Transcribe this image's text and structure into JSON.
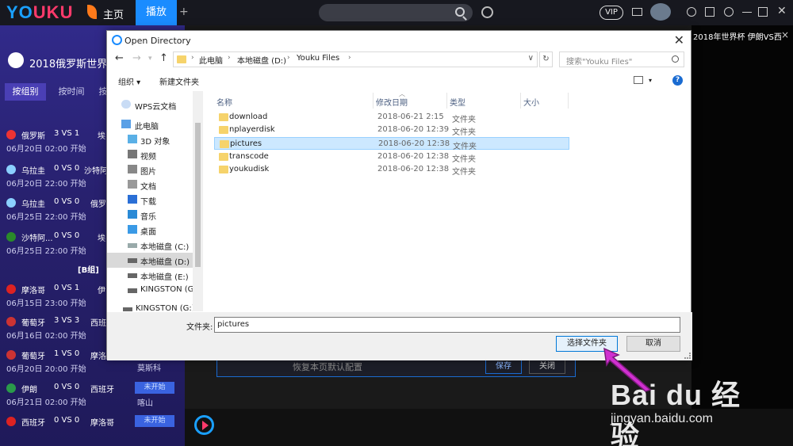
{
  "app": {
    "logo_text_a": "YO",
    "logo_text_b": "UKU",
    "nav_home": "主页",
    "nav_play": "播放",
    "nav_plus": "+",
    "vip": "VIP",
    "right_title": "2018年世界杯 伊朗VS西",
    "right_close": "×",
    "colors": {
      "accent": "#1a8cff",
      "brand_pink": "#ff3a6b",
      "panel": "#2b247a"
    }
  },
  "worldcup": {
    "title": "2018俄罗斯世界杯",
    "tabs": [
      "按组别",
      "按时间",
      "按"
    ],
    "group_b": "[B组]",
    "matches": [
      {
        "team": "俄罗斯",
        "score": "3 VS 1",
        "opp": "埃",
        "time": "06月20日 02:00 开始"
      },
      {
        "team": "乌拉圭",
        "score": "0 VS 0",
        "opp": "沙特阿",
        "time": "06月20日 22:00 开始"
      },
      {
        "team": "乌拉圭",
        "score": "0 VS 0",
        "opp": "俄罗",
        "time": "06月25日 22:00 开始"
      },
      {
        "team": "沙特阿...",
        "score": "0 VS 0",
        "opp": "埃",
        "time": "06月25日 22:00 开始"
      },
      {
        "team": "摩洛哥",
        "score": "0 VS 1",
        "opp": "伊",
        "time": "06月15日 23:00 开始"
      },
      {
        "team": "葡萄牙",
        "score": "3 VS 3",
        "opp": "西班",
        "time": "06月16日 02:00 开始"
      },
      {
        "team": "葡萄牙",
        "score": "1 VS 0",
        "opp": "摩洛",
        "time": "06月20日 20:00 开始"
      },
      {
        "team": "伊朗",
        "score": "0 VS 0",
        "opp": "西班牙",
        "time": "06月21日 02:00 开始"
      },
      {
        "team": "西班牙",
        "score": "0 VS 0",
        "opp": "摩洛哥",
        "time": ""
      }
    ],
    "side_labels": [
      "莫斯科",
      "未开始",
      "喀山",
      "未开始"
    ]
  },
  "settings_bar": {
    "reset": "恢复本页默认配置",
    "save": "保存",
    "close": "关闭"
  },
  "watermark": {
    "brand": "Bai du 经验",
    "url": "jingyan.baidu.com"
  },
  "dialog": {
    "title": "Open Directory",
    "close": "✕",
    "nav": {
      "back": "←",
      "forward": "→",
      "up": "↑"
    },
    "breadcrumbs": [
      "此电脑",
      "本地磁盘 (D:)",
      "Youku Files"
    ],
    "search_placeholder": "搜索\"Youku Files\"",
    "toolbar": {
      "organize": "组织 ▾",
      "new_folder": "新建文件夹"
    },
    "nav_items": [
      {
        "label": "WPS云文档",
        "icon": "cloud-icon"
      },
      {
        "label": "此电脑",
        "icon": "computer-icon"
      },
      {
        "label": "3D 对象",
        "icon": "cube-icon"
      },
      {
        "label": "视频",
        "icon": "video-icon"
      },
      {
        "label": "图片",
        "icon": "picture-icon"
      },
      {
        "label": "文档",
        "icon": "document-icon"
      },
      {
        "label": "下载",
        "icon": "download-icon"
      },
      {
        "label": "音乐",
        "icon": "music-icon"
      },
      {
        "label": "桌面",
        "icon": "desktop-icon"
      },
      {
        "label": "本地磁盘 (C:)",
        "icon": "drive-icon"
      },
      {
        "label": "本地磁盘 (D:)",
        "icon": "drive-icon"
      },
      {
        "label": "本地磁盘 (E:)",
        "icon": "drive-icon"
      },
      {
        "label": "KINGSTON (G:)",
        "icon": "usb-drive-icon"
      },
      {
        "label": "KINGSTON (G:)",
        "icon": "usb-drive-icon"
      }
    ],
    "columns": [
      "名称",
      "修改日期",
      "类型",
      "大小"
    ],
    "files": [
      {
        "name": "download",
        "date": "2018-06-21 2:15",
        "type": "文件夹"
      },
      {
        "name": "nplayerdisk",
        "date": "2018-06-20 12:39",
        "type": "文件夹"
      },
      {
        "name": "pictures",
        "date": "2018-06-20 12:38",
        "type": "文件夹"
      },
      {
        "name": "transcode",
        "date": "2018-06-20 12:38",
        "type": "文件夹"
      },
      {
        "name": "youkudisk",
        "date": "2018-06-20 12:38",
        "type": "文件夹"
      }
    ],
    "folder_label": "文件夹:",
    "folder_value": "pictures",
    "select_button": "选择文件夹",
    "cancel_button": "取消"
  }
}
